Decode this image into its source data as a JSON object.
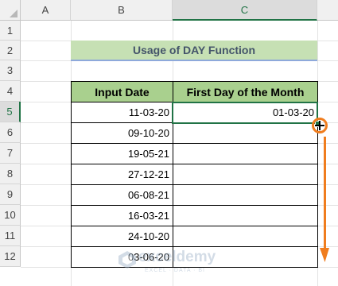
{
  "columns": [
    "A",
    "B",
    "C"
  ],
  "rows": [
    "1",
    "2",
    "3",
    "4",
    "5",
    "6",
    "7",
    "8",
    "9",
    "10",
    "11",
    "12"
  ],
  "title": "Usage of DAY Function",
  "table": {
    "headers": [
      "Input Date",
      "First Day of the Month"
    ],
    "rows": [
      {
        "input": "11-03-20",
        "first": "01-03-20"
      },
      {
        "input": "09-10-20",
        "first": ""
      },
      {
        "input": "19-05-21",
        "first": ""
      },
      {
        "input": "27-12-21",
        "first": ""
      },
      {
        "input": "06-08-21",
        "first": ""
      },
      {
        "input": "16-03-21",
        "first": ""
      },
      {
        "input": "24-10-20",
        "first": ""
      },
      {
        "input": "03-06-20",
        "first": ""
      }
    ]
  },
  "watermark": {
    "name": "exceldemy",
    "tagline": "EXCEL · DATA · BI"
  },
  "colors": {
    "accent": "#217346",
    "annotation": "#f07d1e",
    "title_bg": "#c6e0b4",
    "header_bg": "#a9d08e"
  }
}
